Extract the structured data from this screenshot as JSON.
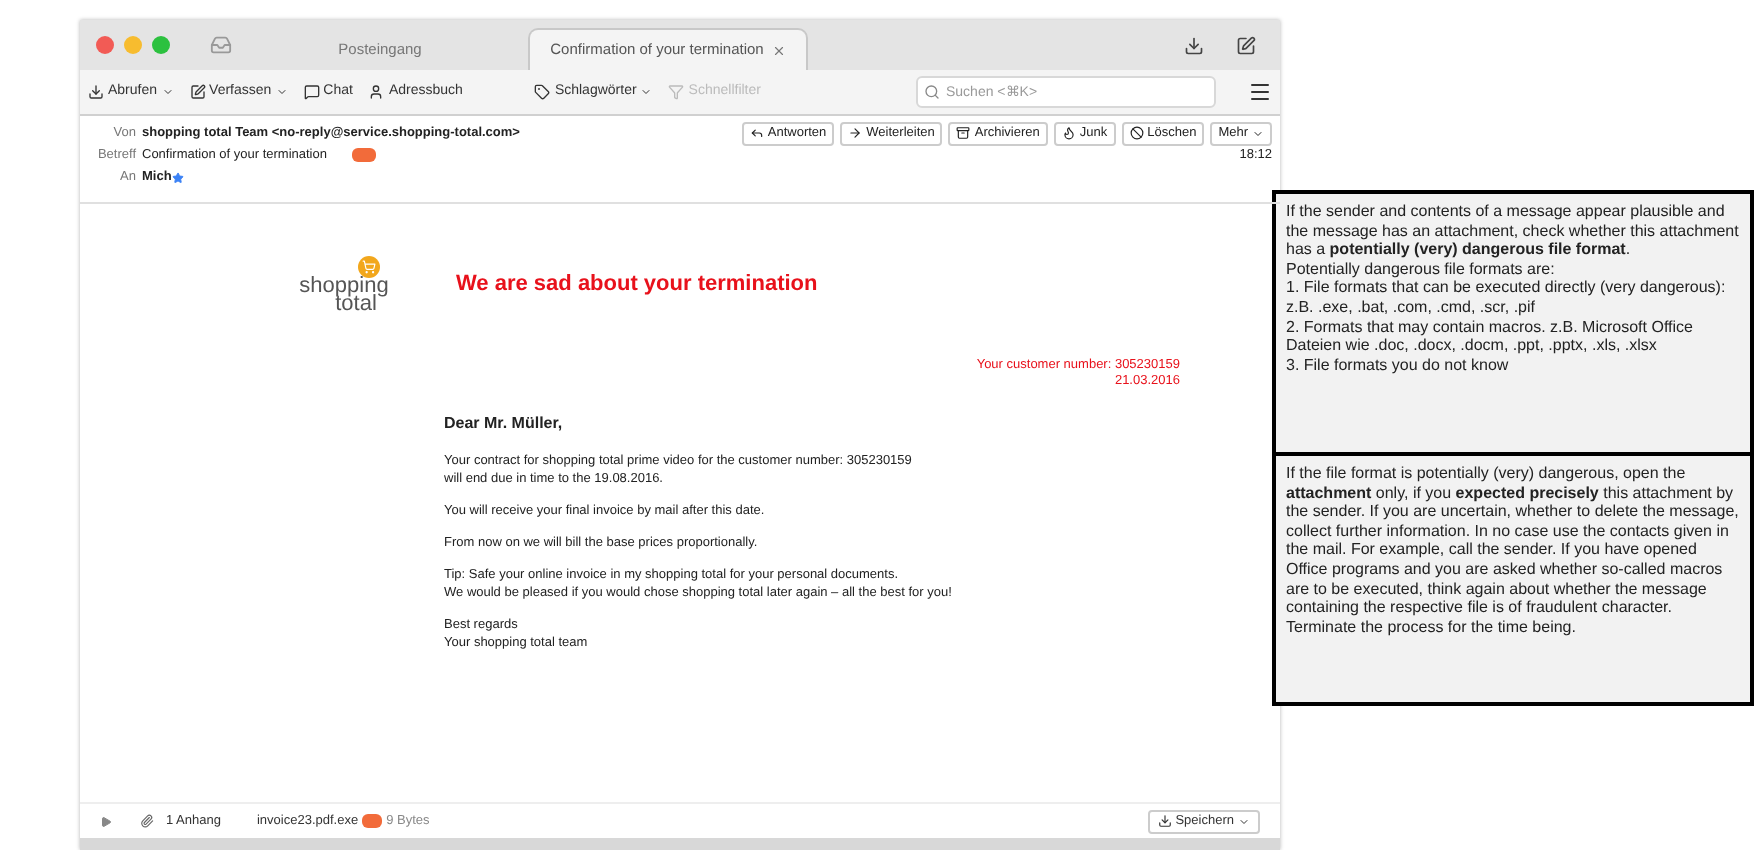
{
  "window": {
    "tabs": [
      {
        "label": "Posteingang",
        "selected": false
      },
      {
        "label": "Confirmation of your termination",
        "selected": true
      }
    ]
  },
  "toolbar": {
    "buttons": [
      {
        "label": "Abrufen",
        "disabled": false
      },
      {
        "label": "Verfassen",
        "disabled": false
      },
      {
        "label": "Chat",
        "disabled": false
      },
      {
        "label": "Adressbuch",
        "disabled": false
      },
      {
        "label": "Schlagwörter",
        "disabled": false
      },
      {
        "label": "Schnellfilter",
        "disabled": true
      }
    ],
    "search": {
      "placeholder": "Suchen <⌘K>"
    }
  },
  "header": {
    "from_label": "Von",
    "from": "shopping total Team <no-reply@service.shopping-total.com>",
    "subject_label": "Betreff",
    "subject": "Confirmation of your termination",
    "to_label": "An",
    "to": "Mich",
    "time": "18:12",
    "actions": [
      "Antworten",
      "Weiterleiten",
      "Archivieren",
      "Junk",
      "Löschen",
      "Mehr"
    ]
  },
  "message": {
    "logo": [
      "shopping",
      "total"
    ],
    "headline": "We are sad about your termination",
    "customer_number": "Your customer number: 305230159",
    "date": "21.03.2016",
    "greeting": "Dear Mr. Müller,",
    "paragraphs": [
      [
        "Your contract for shopping total prime video for the customer number: 305230159",
        "will end due in time to the 19.08.2016."
      ],
      [
        "You will receive your final invoice by mail after this date."
      ],
      [
        "From now on we will bill the base prices proportionally."
      ],
      [
        "Tip: Safe your online invoice in my shopping total for your personal documents.",
        "We would be pleased if you would chose shopping total later again – all the best for you!"
      ],
      [
        "Best regards",
        "Your shopping total team"
      ]
    ]
  },
  "attachments": {
    "count": "1 Anhang",
    "file": "invoice23.pdf.exe",
    "size": "9 Bytes",
    "save": "Speichern"
  },
  "notes": [
    [
      "If the sender and contents of a message appear plausible and the message has an attachment, check whether this attachment has a **potentially (very) dangerous file format**.",
      "Potentially dangerous file formats are:",
      "1. File formats that can be executed directly (very dangerous): z.B. .exe, .bat, .com, .cmd, .scr, .pif",
      "2. Formats that may contain macros. z.B. Microsoft Office Dateien wie .doc, .docx, .docm, .ppt, .pptx, .xls, .xlsx",
      "3. File formats you do not know"
    ],
    [
      "If the file format is potentially (very) dangerous, open the **attachment** only, if you **expected precisely** this attachment by the sender. If you are uncertain, whether to delete the message, collect further information. In no case use the contacts given in the mail. For example, call the sender. If you have opened Office programs and you are asked whether so-called macros are to be executed, think again about whether the message containing the respective file is of fraudulent character. Terminate the process for the time being."
    ]
  ]
}
